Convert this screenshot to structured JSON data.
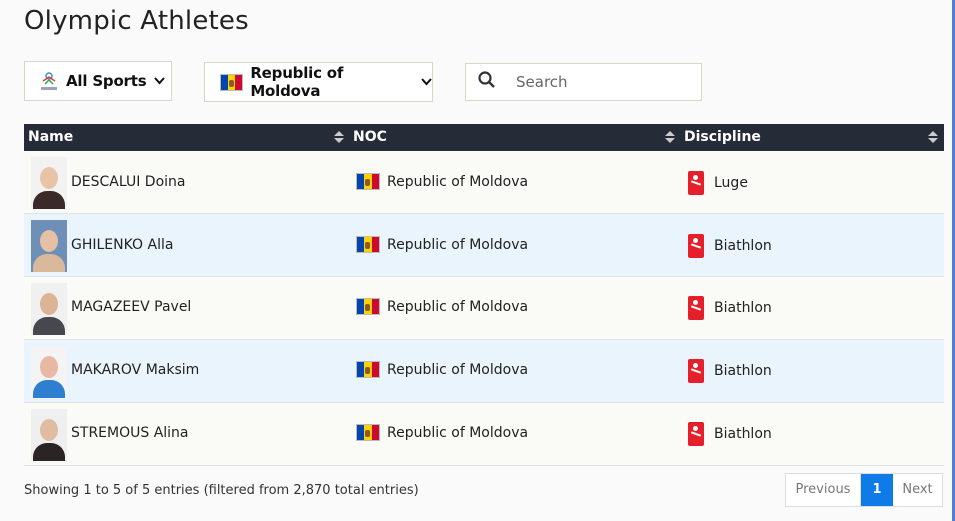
{
  "page": {
    "title": "Olympic Athletes"
  },
  "filters": {
    "sport": {
      "label": "All Sports",
      "icon": "olympic-games-logo-icon"
    },
    "noc": {
      "label": "Republic of Moldova",
      "icon": "moldova-flag-icon"
    },
    "search": {
      "placeholder": "Search",
      "icon": "search-icon"
    }
  },
  "table": {
    "columns": [
      {
        "label": "Name"
      },
      {
        "label": "NOC"
      },
      {
        "label": "Discipline"
      }
    ],
    "rows": [
      {
        "name": "DESCALUI Doina",
        "noc": "Republic of Moldova",
        "discipline": "Luge",
        "discipline_icon": "luge-icon"
      },
      {
        "name": "GHILENKO Alla",
        "noc": "Republic of Moldova",
        "discipline": "Biathlon",
        "discipline_icon": "biathlon-icon"
      },
      {
        "name": "MAGAZEEV Pavel",
        "noc": "Republic of Moldova",
        "discipline": "Biathlon",
        "discipline_icon": "biathlon-icon"
      },
      {
        "name": "MAKAROV Maksim",
        "noc": "Republic of Moldova",
        "discipline": "Biathlon",
        "discipline_icon": "biathlon-icon"
      },
      {
        "name": "STREMOUS Alina",
        "noc": "Republic of Moldova",
        "discipline": "Biathlon",
        "discipline_icon": "biathlon-icon"
      }
    ]
  },
  "footer": {
    "info": "Showing 1 to 5 of 5 entries (filtered from 2,870 total entries)",
    "pagination": {
      "previous": "Previous",
      "current": "1",
      "next": "Next"
    }
  },
  "colors": {
    "header_bg": "#262b38",
    "row_alt": "#eaf4fc",
    "accent": "#0e7be8",
    "discipline_red": "#e6202a"
  }
}
